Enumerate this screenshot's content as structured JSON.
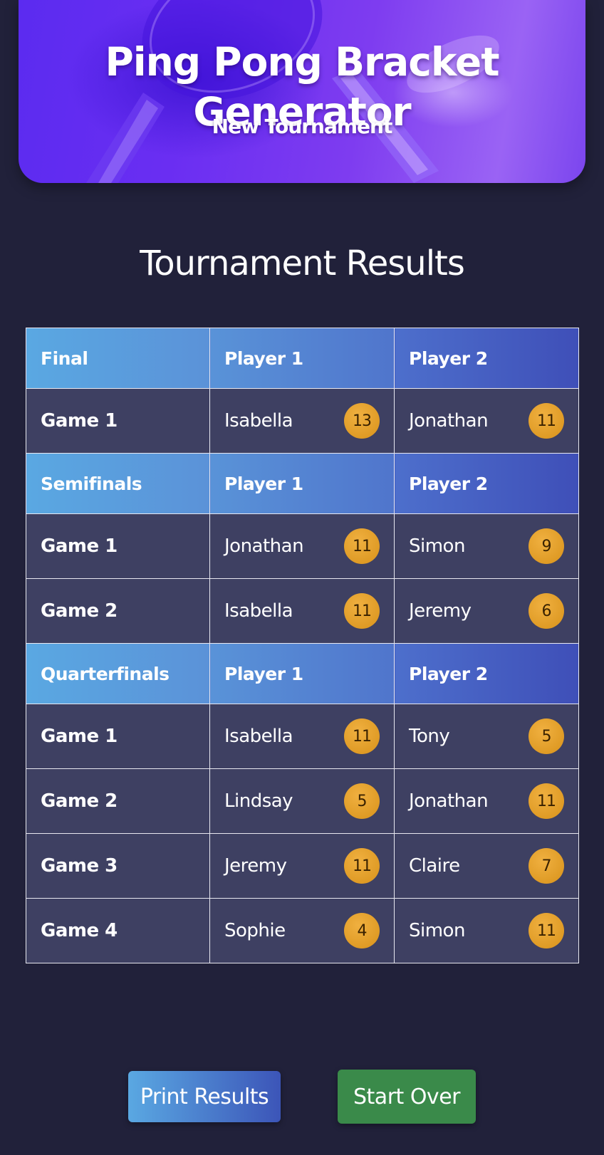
{
  "header": {
    "title": "Ping Pong Bracket Generator",
    "subtitle": "New Tournament"
  },
  "results": {
    "title": "Tournament Results",
    "rounds": [
      {
        "name": "Final",
        "player1_label": "Player 1",
        "player2_label": "Player 2",
        "games": [
          {
            "label": "Game 1",
            "p1": "Isabella",
            "s1": "13",
            "p2": "Jonathan",
            "s2": "11"
          }
        ]
      },
      {
        "name": "Semifinals",
        "player1_label": "Player 1",
        "player2_label": "Player 2",
        "games": [
          {
            "label": "Game 1",
            "p1": "Jonathan",
            "s1": "11",
            "p2": "Simon",
            "s2": "9"
          },
          {
            "label": "Game 2",
            "p1": "Isabella",
            "s1": "11",
            "p2": "Jeremy",
            "s2": "6"
          }
        ]
      },
      {
        "name": "Quarterfinals",
        "player1_label": "Player 1",
        "player2_label": "Player 2",
        "games": [
          {
            "label": "Game 1",
            "p1": "Isabella",
            "s1": "11",
            "p2": "Tony",
            "s2": "5"
          },
          {
            "label": "Game 2",
            "p1": "Lindsay",
            "s1": "5",
            "p2": "Jonathan",
            "s2": "11"
          },
          {
            "label": "Game 3",
            "p1": "Jeremy",
            "s1": "11",
            "p2": "Claire",
            "s2": "7"
          },
          {
            "label": "Game 4",
            "p1": "Sophie",
            "s1": "4",
            "p2": "Simon",
            "s2": "11"
          }
        ]
      }
    ]
  },
  "actions": {
    "print_label": "Print Results",
    "start_over_label": "Start Over"
  },
  "colors": {
    "background": "#21213a",
    "row": "#3e4062",
    "score_badge": "#e3a02c",
    "start_button": "#3a8a4a",
    "hero": "#6a2ef2"
  },
  "icons": {
    "hero_image": "ping-pong-paddles-icon"
  }
}
